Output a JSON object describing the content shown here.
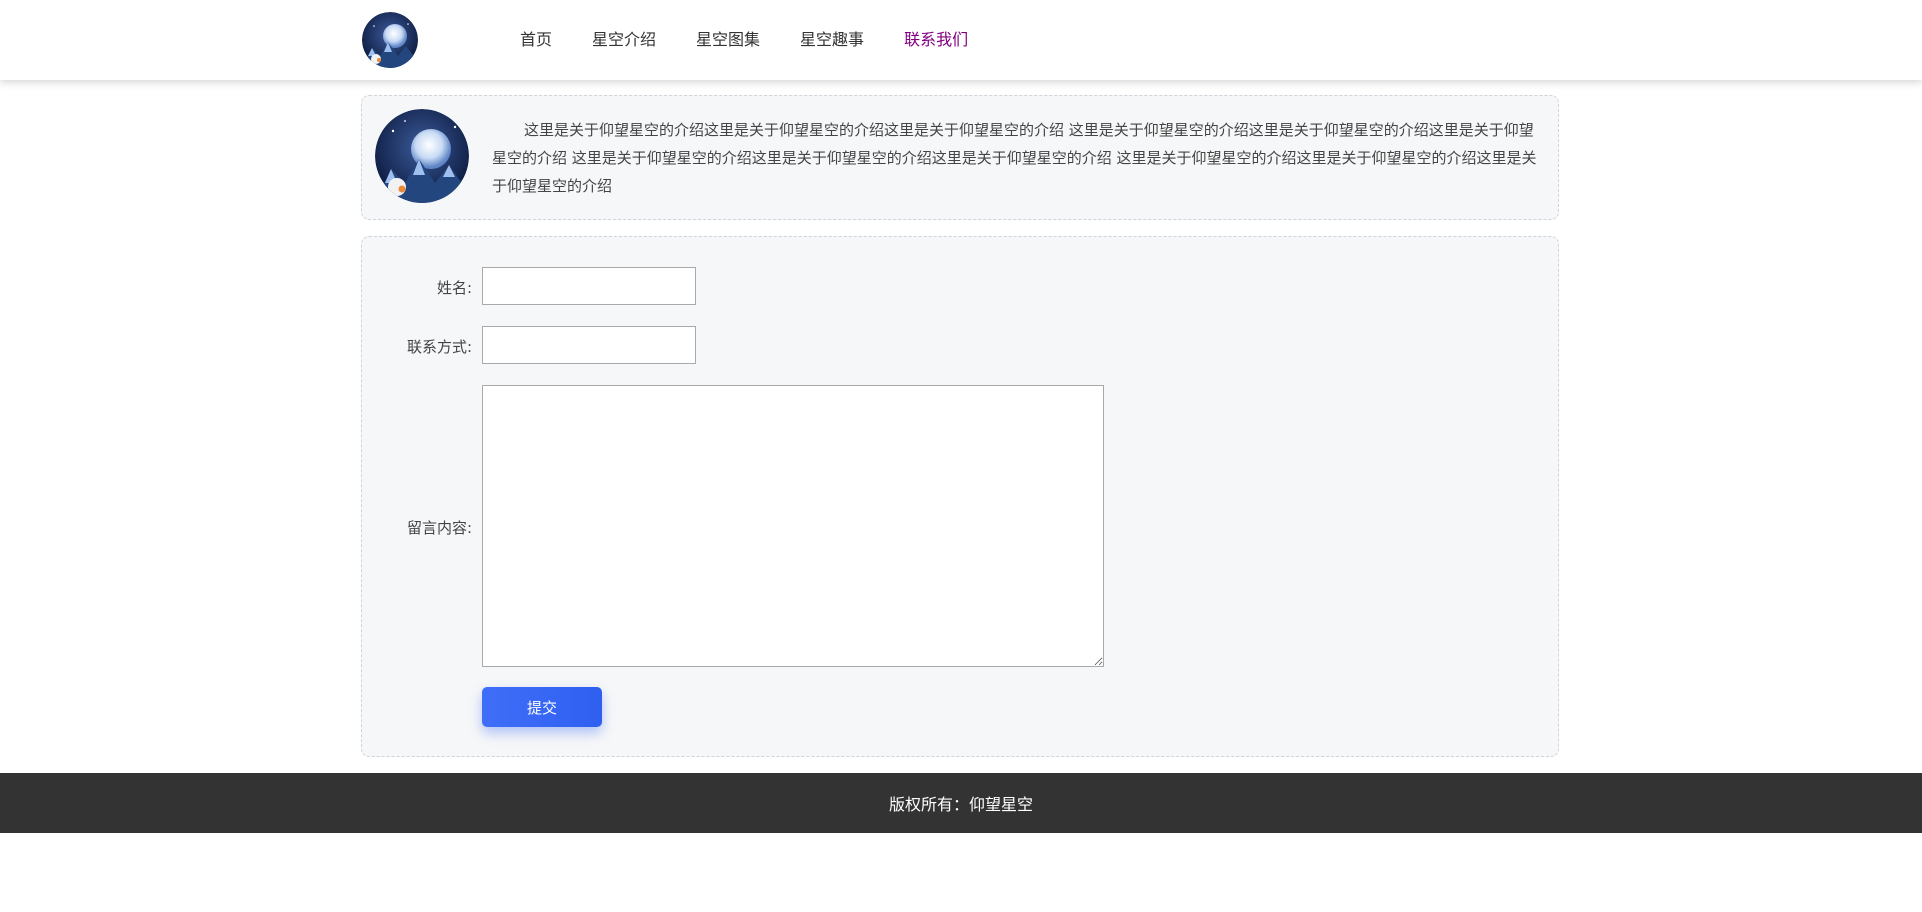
{
  "header": {
    "nav": [
      {
        "label": "首页"
      },
      {
        "label": "星空介绍"
      },
      {
        "label": "星空图集"
      },
      {
        "label": "星空趣事"
      },
      {
        "label": "联系我们"
      }
    ],
    "active_color": "#800080"
  },
  "intro": {
    "text": "这里是关于仰望星空的介绍这里是关于仰望星空的介绍这里是关于仰望星空的介绍 这里是关于仰望星空的介绍这里是关于仰望星空的介绍这里是关于仰望星空的介绍 这里是关于仰望星空的介绍这里是关于仰望星空的介绍这里是关于仰望星空的介绍 这里是关于仰望星空的介绍这里是关于仰望星空的介绍这里是关于仰望星空的介绍"
  },
  "form": {
    "name_label": "姓名:",
    "name_value": "",
    "contact_label": "联系方式:",
    "contact_value": "",
    "message_label": "留言内容:",
    "message_value": "",
    "submit_label": "提交",
    "submit_color": "#3a66f5"
  },
  "footer": {
    "text": "版权所有：仰望星空"
  }
}
